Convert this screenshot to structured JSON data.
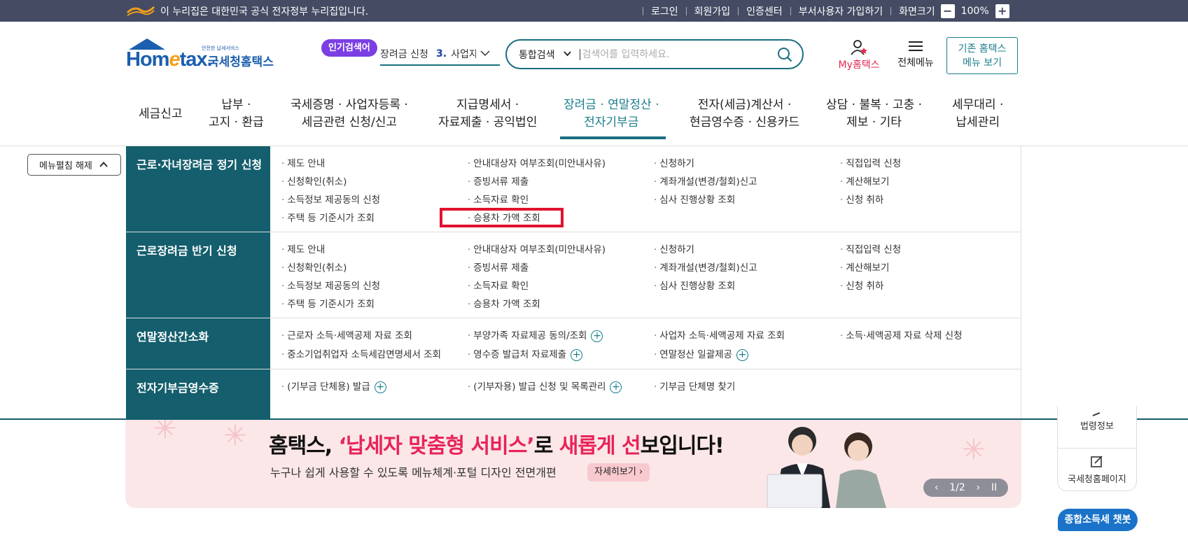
{
  "topbar": {
    "gov_notice": "이 누리집은 대한민국 공식 전자정부 누리집입니다.",
    "links": [
      "로그인",
      "회원가입",
      "인증센터",
      "부서사용자 가입하기"
    ],
    "zoom_label": "화면크기",
    "zoom_minus": "−",
    "zoom_value": "100%",
    "zoom_plus": "+"
  },
  "header": {
    "logo_brand_a": "Hom",
    "logo_brand_b": "e",
    "logo_brand_c": "tax.",
    "logo_sub": "안전한 납세서비스",
    "logo_kor": "국세청홈택스",
    "popular_badge": "인기검색어",
    "ticker_text1": "장려금 신청",
    "ticker_num": "3.",
    "ticker_text2": "사업자",
    "search_scope": "통합검색",
    "search_placeholder": "검색어를 입력하세요.",
    "my_hometax": "My홈택스",
    "all_menu": "전체메뉴",
    "old_hometax_line1": "기존 홈택스",
    "old_hometax_line2": "메뉴 보기"
  },
  "gnb": [
    {
      "line1": "세금신고",
      "line2": ""
    },
    {
      "line1": "납부 ·",
      "line2": "고지 · 환급"
    },
    {
      "line1": "국세증명 · 사업자등록 ·",
      "line2": "세금관련 신청/신고"
    },
    {
      "line1": "지급명세서 ·",
      "line2": "자료제출 · 공익법인"
    },
    {
      "line1": "장려금 · 연말정산 ·",
      "line2": "전자기부금"
    },
    {
      "line1": "전자(세금)계산서 ·",
      "line2": "현금영수증 · 신용카드"
    },
    {
      "line1": "상담 · 불복 · 고충 ·",
      "line2": "제보 · 기타"
    },
    {
      "line1": "세무대리 ·",
      "line2": "납세관리"
    }
  ],
  "menu_toggle": "메뉴펼침 해제",
  "mega": {
    "sections": [
      {
        "head": "근로·자녀장려금 정기 신청",
        "items": [
          "제도 안내",
          "안내대상자 여부조회(미안내사유)",
          "신청하기",
          "직접입력 신청",
          "신청확인(취소)",
          "증빙서류 제출",
          "계좌개설(변경/철회)신고",
          "계산해보기",
          "소득정보 제공동의 신청",
          "소득자료 확인",
          "심사 진행상황 조회",
          "신청 취하",
          "주택 등 기준시가 조회",
          "승용차 가액 조회"
        ]
      },
      {
        "head": "근로장려금 반기 신청",
        "items": [
          "제도 안내",
          "안내대상자 여부조회(미안내사유)",
          "신청하기",
          "직접입력 신청",
          "신청확인(취소)",
          "증빙서류 제출",
          "계좌개설(변경/철회)신고",
          "계산해보기",
          "소득정보 제공동의 신청",
          "소득자료 확인",
          "심사 진행상황 조회",
          "신청 취하",
          "주택 등 기준시가 조회",
          "승용차 가액 조회"
        ]
      },
      {
        "head": "연말정산간소화",
        "items": [
          "근로자 소득·세액공제 자료 조회",
          "부양가족 자료제공 동의/조회",
          "사업자 소득·세액공제 자료 조회",
          "소득·세액공제 자료 삭제 신청",
          "중소기업취업자 소득세감면명세서 조회",
          "영수증 발급처 자료제출",
          "연말정산 일괄제공"
        ]
      },
      {
        "head": "전자기부금영수증",
        "items": [
          "(기부금 단체용) 발급",
          "(기부자용) 발급 신청 및 목록관리",
          "기부금 단체명 찾기"
        ]
      }
    ]
  },
  "banner": {
    "title_a": "홈택스, ",
    "title_b": "‘납세자 맞춤형 서비스’",
    "title_c": "로 ",
    "title_d": "새롭게 선",
    "title_e": "보입니다!",
    "subtitle": "누구나 쉽게 사용할 수 있도록 메뉴체계·포털 디자인 전면개편",
    "more": "자세히보기",
    "pager_prev": "‹",
    "pager_text": "1/2",
    "pager_next": "›",
    "pager_pause": "II"
  },
  "quick": {
    "item1": "법령정보",
    "item2": "국세청홈페이지"
  },
  "chatbot": "종합소득세 챗봇",
  "colors": {
    "topbar": "#454b63",
    "teal": "#145e6d",
    "accent": "#1a7d8c",
    "highlight": "#e0122f",
    "banner_bg": "#fbe7e8",
    "pink": "#e8245a"
  }
}
